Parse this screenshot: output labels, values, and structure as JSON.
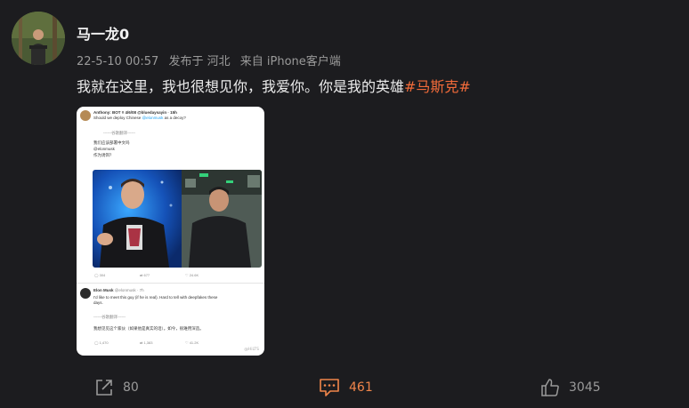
{
  "author": {
    "name": "马一龙0",
    "time": "22-5-10 00:57",
    "posted_from": "发布于 河北",
    "via": "来自 iPhone客户端"
  },
  "post": {
    "text": "我就在这里，我也很想见你，我爱你。你是我的英雄",
    "hashtag": "#马斯克#"
  },
  "embed": {
    "tweet1": {
      "header": "Anthony: BOT # 4/6/08 @bluedaysayin · 15h",
      "question_prefix": "Should we deploy Chinese",
      "question_handle": "@elonmusk",
      "question_suffix": "as a decoy?",
      "separator": "------谷歌翻译------",
      "translation_1": "我们应该部署中文吗",
      "translation_2": "@elonmusk",
      "translation_3": "作为诱饵？",
      "replies": "304",
      "retweets": "677",
      "likes": "24.6K"
    },
    "tweet2": {
      "name": "Elon Musk",
      "handle": "@elonmusk · 7h",
      "line1": "I'd like to meet this guy (if he is real). Hard to tell with deepfakes these",
      "line2": "days.",
      "separator": "------谷歌翻译------",
      "translation": "我想见见这个家伙（如果他是真实的话）。如今，很难用深造。",
      "replies": "1,470",
      "retweets": "1,383",
      "likes": "41.2K"
    },
    "watermark": "@HiLTS"
  },
  "actions": {
    "share_count": "80",
    "comment_count": "461",
    "like_count": "3045"
  },
  "colors": {
    "background": "#1c1c1f",
    "accent": "#f0854a",
    "hashtag": "#f26b3a"
  }
}
